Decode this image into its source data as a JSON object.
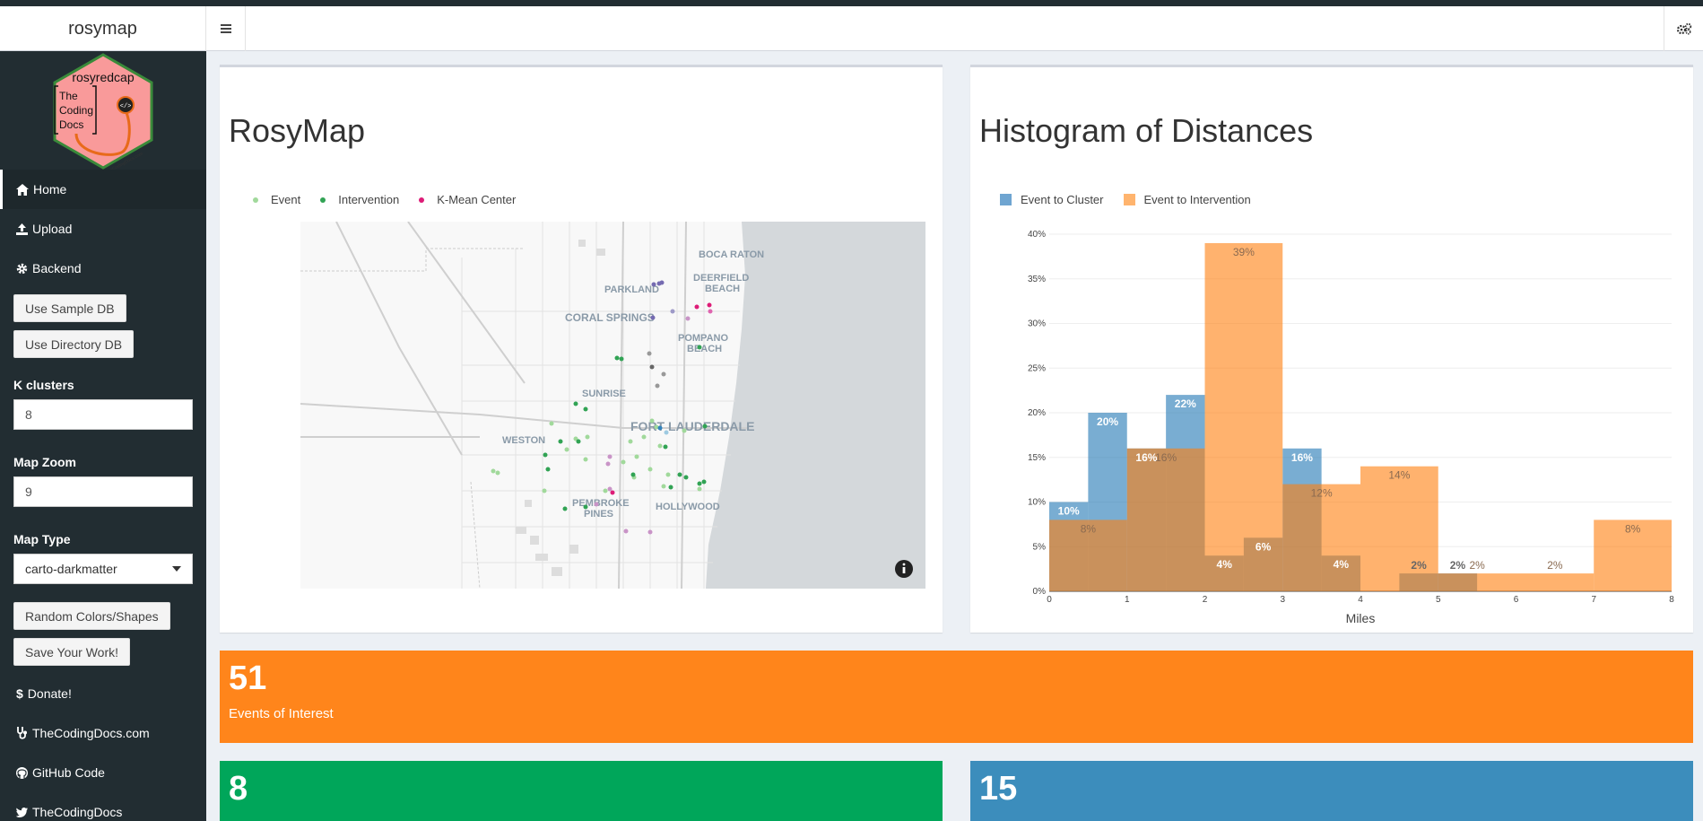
{
  "app": {
    "title": "rosymap"
  },
  "header": {
    "toggle_icon": "hamburger-icon",
    "settings_icon": "gears-icon"
  },
  "sidebar": {
    "logo": {
      "title": "rosyredcap",
      "line1": "The",
      "line2": "Coding",
      "line3": "Docs",
      "url": "TheCodingDocs.com"
    },
    "menu": [
      {
        "label": "Home",
        "icon": "home-icon"
      },
      {
        "label": "Upload",
        "icon": "upload-icon"
      },
      {
        "label": "Backend",
        "icon": "gear-icon"
      }
    ],
    "buttons": {
      "sample_db": "Use Sample DB",
      "directory_db": "Use Directory DB",
      "random": "Random Colors/Shapes",
      "save": "Save Your Work!"
    },
    "k_clusters": {
      "label": "K clusters",
      "value": "8"
    },
    "map_zoom": {
      "label": "Map Zoom",
      "value": "9"
    },
    "map_type": {
      "label": "Map Type",
      "value": "carto-darkmatter"
    },
    "links": [
      {
        "label": "Donate!",
        "icon": "dollar-icon"
      },
      {
        "label": "TheCodingDocs.com",
        "icon": "stethoscope-icon"
      },
      {
        "label": "GitHub Code",
        "icon": "github-icon"
      },
      {
        "label": "TheCodingDocs",
        "icon": "twitter-icon"
      }
    ]
  },
  "map_panel": {
    "title": "RosyMap",
    "legend": [
      {
        "label": "Event",
        "color": "#a1d99b"
      },
      {
        "label": "Intervention",
        "color": "#31a354"
      },
      {
        "label": "K-Mean Center",
        "color": "#dd1c77"
      }
    ],
    "place_labels": [
      "BOCA RATON",
      "PARKLAND",
      "DEERFIELD",
      "BEACH",
      "CORAL SPRINGS",
      "POMPANO",
      "BEACH",
      "SUNRISE",
      "FORT LAUDERDALE",
      "WESTON",
      "PEMBROKE",
      "PINES",
      "HOLLYWOOD"
    ],
    "info_icon": "info-icon"
  },
  "hist_panel": {
    "title": "Histogram of Distances",
    "legend": [
      {
        "label": "Event to Cluster",
        "color": "#1f77b4"
      },
      {
        "label": "Event to Intervention",
        "color": "#ff7f0e"
      }
    ]
  },
  "chart_data": {
    "type": "bar",
    "title": "Histogram of Distances",
    "xlabel": "Miles",
    "ylabel": "",
    "xlim": [
      0,
      8
    ],
    "ylim": [
      0,
      40
    ],
    "y_ticks": [
      "0%",
      "5%",
      "10%",
      "15%",
      "20%",
      "25%",
      "30%",
      "35%",
      "40%"
    ],
    "x_ticks": [
      "0",
      "1",
      "2",
      "3",
      "4",
      "5",
      "6",
      "7",
      "8"
    ],
    "series": [
      {
        "name": "Event to Cluster",
        "color": "#1f77b4",
        "bins": [
          {
            "x0": 0,
            "x1": 0.5,
            "value": 10,
            "label": "10%"
          },
          {
            "x0": 0.5,
            "x1": 1,
            "value": 20,
            "label": "20%"
          },
          {
            "x0": 1,
            "x1": 1.5,
            "value": 16,
            "label": "16%"
          },
          {
            "x0": 1.5,
            "x1": 2,
            "value": 22,
            "label": "22%"
          },
          {
            "x0": 2,
            "x1": 2.5,
            "value": 4,
            "label": "4%"
          },
          {
            "x0": 2.5,
            "x1": 3,
            "value": 6,
            "label": "6%"
          },
          {
            "x0": 3,
            "x1": 3.5,
            "value": 16,
            "label": "16%"
          },
          {
            "x0": 3.5,
            "x1": 4,
            "value": 4,
            "label": "4%"
          },
          {
            "x0": 4.5,
            "x1": 5,
            "value": 2,
            "label": "2%"
          },
          {
            "x0": 5,
            "x1": 5.5,
            "value": 2,
            "label": "2%"
          }
        ]
      },
      {
        "name": "Event to Intervention",
        "color": "#ff7f0e",
        "bins": [
          {
            "x0": 0,
            "x1": 1,
            "value": 8,
            "label": "8%"
          },
          {
            "x0": 1,
            "x1": 2,
            "value": 16,
            "label": "16%"
          },
          {
            "x0": 2,
            "x1": 3,
            "value": 39,
            "label": "39%"
          },
          {
            "x0": 3,
            "x1": 4,
            "value": 12,
            "label": "12%"
          },
          {
            "x0": 4,
            "x1": 5,
            "value": 14,
            "label": "14%"
          },
          {
            "x0": 5,
            "x1": 6,
            "value": 2,
            "label": "2%"
          },
          {
            "x0": 6,
            "x1": 7,
            "value": 2,
            "label": "2%"
          },
          {
            "x0": 7,
            "x1": 8,
            "value": 8,
            "label": "8%"
          }
        ]
      }
    ]
  },
  "value_boxes": [
    {
      "value": "51",
      "label": "Events of Interest",
      "color": "#ff851b"
    },
    {
      "value": "8",
      "label": "",
      "color": "#00a65a"
    },
    {
      "value": "15",
      "label": "",
      "color": "#3c8dbc"
    }
  ]
}
